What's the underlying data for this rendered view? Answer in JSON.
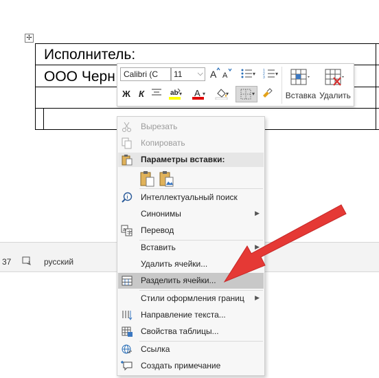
{
  "document": {
    "row1_text": "Исполнитель:",
    "row2_text": "ООО Черн"
  },
  "statusbar": {
    "page_fragment": "37",
    "language": "русский"
  },
  "mini_toolbar": {
    "font_name": "Calibri (С",
    "font_size": "11",
    "bold_label": "Ж",
    "italic_label": "К",
    "insert_label": "Вставка",
    "delete_label": "Удалить"
  },
  "context_menu": {
    "cut": "Вырезать",
    "copy": "Копировать",
    "paste_options_header": "Параметры вставки:",
    "smart_lookup": "Интеллектуальный поиск",
    "synonyms": "Синонимы",
    "translate": "Перевод",
    "insert": "Вставить",
    "delete_cells": "Удалить ячейки...",
    "split_cells": "Разделить ячейки...",
    "border_styles": "Стили оформления границ",
    "text_direction": "Направление текста...",
    "table_properties": "Свойства таблицы...",
    "link": "Ссылка",
    "new_comment": "Создать примечание"
  },
  "colors": {
    "arrow": "#e53935",
    "highlight_yellow": "#ffff00",
    "font_red": "#e00000",
    "menu_highlight": "#c8c8c8"
  }
}
